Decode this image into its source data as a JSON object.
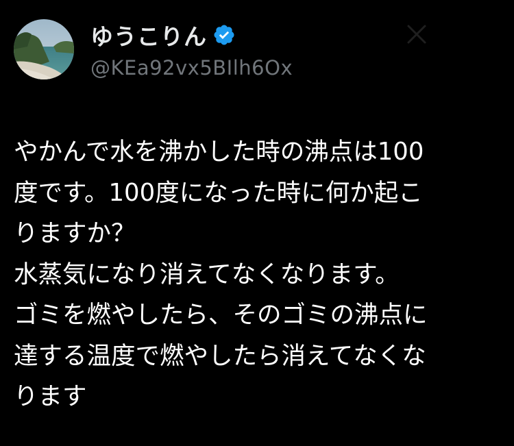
{
  "post": {
    "author": {
      "display_name": "ゆうこりん",
      "handle": "@KEa92vx5BIlh6Ox",
      "verified_icon": "verified-badge-icon",
      "avatar_icon": "avatar-beach-photo"
    },
    "close_icon": "close-icon",
    "text_lines": [
      "やかんで水を沸かした時の沸点は100",
      "度です。100度になった時に何か起こ",
      "りますか？",
      "水蒸気になり消えてなくなります。",
      "ゴミを燃やしたら、そのゴミの沸点に",
      "達する温度で燃やしたら消えてなくな",
      "ります"
    ]
  },
  "colors": {
    "background": "#000000",
    "text_primary": "#ffffff",
    "text_secondary": "#71767b",
    "verified_blue": "#1d9bf0"
  }
}
